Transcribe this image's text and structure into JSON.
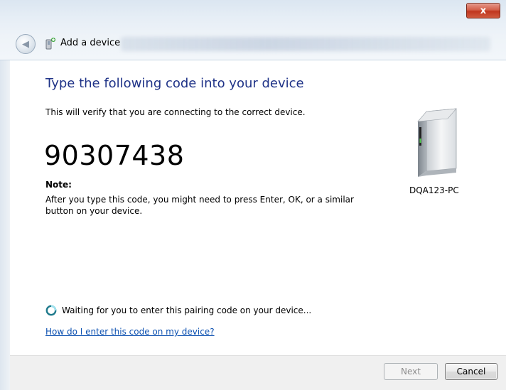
{
  "window": {
    "title": "Add a device",
    "close_glyph": "x"
  },
  "main": {
    "heading": "Type the following code into your device",
    "description": "This will verify that you are connecting to the correct device.",
    "code": "90307438",
    "note_label": "Note:",
    "note_text": "After you type this code, you might need to press Enter, OK, or a similar button on your device.",
    "device_name": "DQA123-PC",
    "waiting_text": "Waiting for you to enter this pairing code on your device...",
    "help_link": "How do I enter this code on my device?"
  },
  "footer": {
    "next_label": "Next",
    "cancel_label": "Cancel"
  },
  "icons": {
    "back": "back-arrow-icon",
    "title": "add-device-icon",
    "device": "pc-tower-icon",
    "waiting": "spinner-icon",
    "close": "close-icon"
  },
  "colors": {
    "heading": "#1e3287",
    "link": "#0a4fb0",
    "close_button": "#c0361f"
  }
}
